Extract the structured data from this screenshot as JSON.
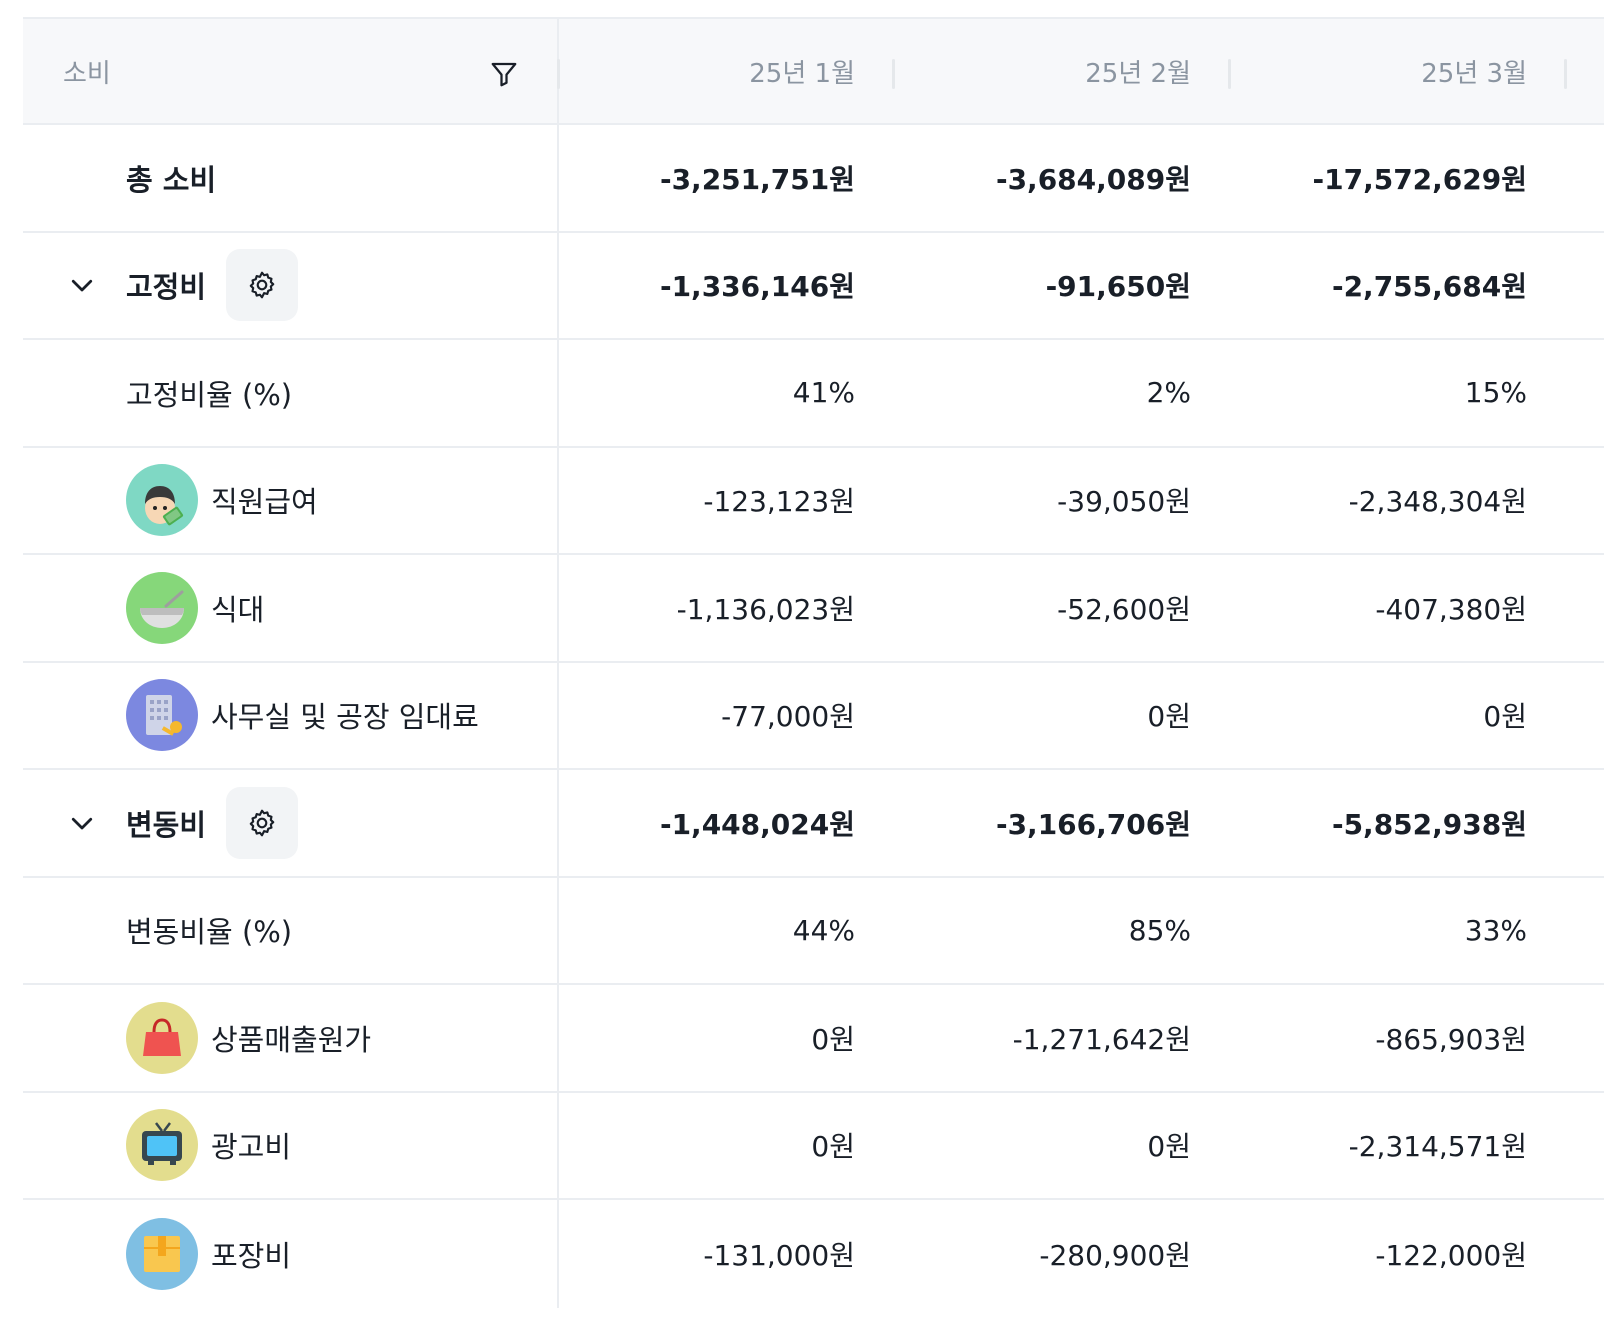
{
  "header": {
    "category_label": "소비",
    "months": [
      "25년 1월",
      "25년 2월",
      "25년 3월"
    ]
  },
  "rows": {
    "total": {
      "label": "총 소비",
      "values": [
        "-3,251,751원",
        "-3,684,089원",
        "-17,572,629원"
      ]
    },
    "fixed": {
      "label": "고정비",
      "values": [
        "-1,336,146원",
        "-91,650원",
        "-2,755,684원"
      ]
    },
    "fixed_ratio": {
      "label": "고정비율 (%)",
      "values": [
        "41%",
        "2%",
        "15%"
      ]
    },
    "salary": {
      "label": "직원급여",
      "icon": "employee-salary-icon",
      "icon_bg": "#7fd8c4",
      "values": [
        "-123,123원",
        "-39,050원",
        "-2,348,304원"
      ]
    },
    "meals": {
      "label": "식대",
      "icon": "bowl-icon",
      "icon_bg": "#86d77a",
      "values": [
        "-1,136,023원",
        "-52,600원",
        "-407,380원"
      ]
    },
    "rent": {
      "label": "사무실 및 공장 임대료",
      "icon": "building-key-icon",
      "icon_bg": "#7c88e0",
      "values": [
        "-77,000원",
        "0원",
        "0원"
      ]
    },
    "variable": {
      "label": "변동비",
      "values": [
        "-1,448,024원",
        "-3,166,706원",
        "-5,852,938원"
      ]
    },
    "variable_ratio": {
      "label": "변동비율 (%)",
      "values": [
        "44%",
        "85%",
        "33%"
      ]
    },
    "cogs": {
      "label": "상품매출원가",
      "icon": "shopping-bag-icon",
      "icon_bg": "#e3dd8e",
      "values": [
        "0원",
        "-1,271,642원",
        "-865,903원"
      ]
    },
    "ads": {
      "label": "광고비",
      "icon": "tv-icon",
      "icon_bg": "#e3dd8e",
      "values": [
        "0원",
        "0원",
        "-2,314,571원"
      ]
    },
    "packaging": {
      "label": "포장비",
      "icon": "box-icon",
      "icon_bg": "#7fbfe3",
      "values": [
        "-131,000원",
        "-280,900원",
        "-122,000원"
      ]
    }
  }
}
